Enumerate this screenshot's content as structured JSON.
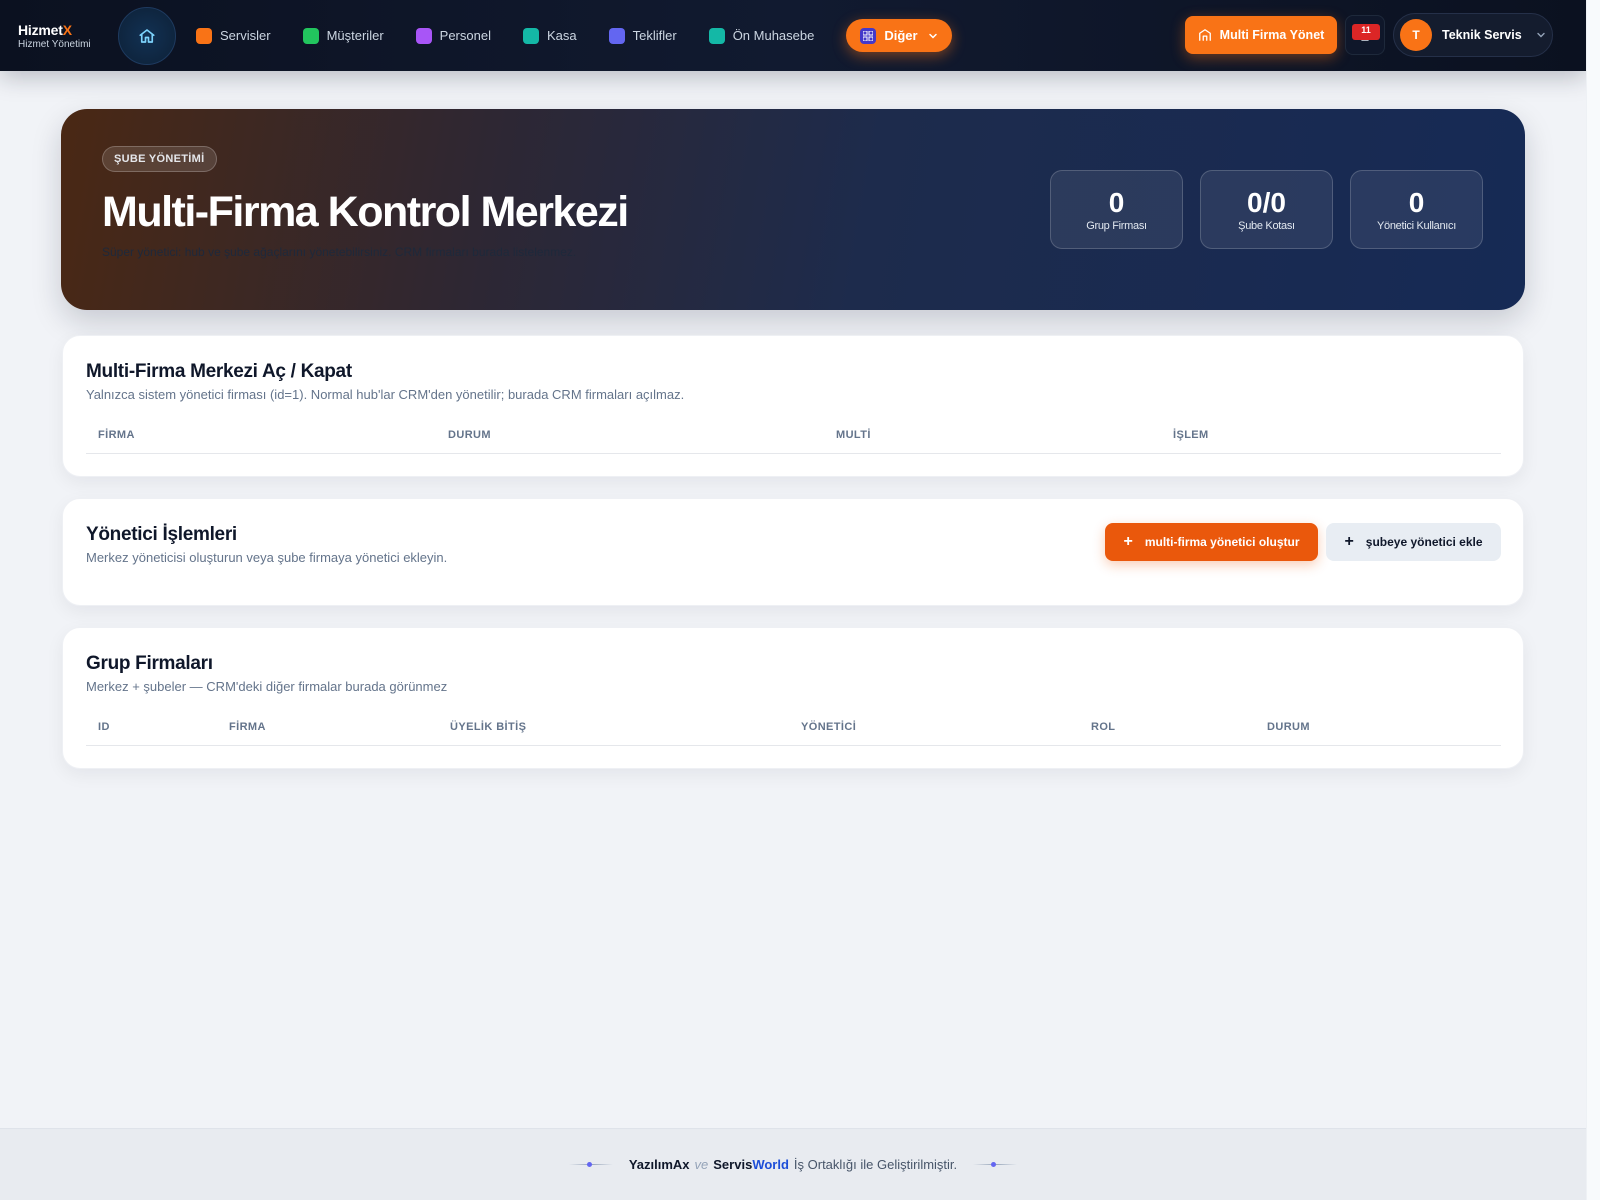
{
  "brand": {
    "name_main": "Hizmet",
    "name_accent": "X",
    "subtitle": "Hizmet Yönetimi"
  },
  "nav": {
    "items": [
      {
        "label": "Servisler",
        "color": "#f97316"
      },
      {
        "label": "Müşteriler",
        "color": "#22c55e"
      },
      {
        "label": "Personel",
        "color": "#a855f7"
      },
      {
        "label": "Kasa",
        "color": "#14b8a6"
      },
      {
        "label": "Teklifler",
        "color": "#6366f1"
      },
      {
        "label": "Ön Muhasebe",
        "color": "#14b8a6"
      }
    ],
    "more_label": "Diğer",
    "multi_firma_label": "Multi Firma Yönet",
    "notification_count": "11",
    "user_initial": "T",
    "user_name": "Teknik Servis"
  },
  "hero": {
    "tag": "ŞUBE YÖNETİMİ",
    "title": "Multi-Firma Kontrol Merkezi",
    "description": "Süper yönetici: hub ve şube ağaçlarını yönetebilirsiniz. CRM firmaları burada listelenmez.",
    "stats": [
      {
        "value": "0",
        "label": "Grup Firması"
      },
      {
        "value": "0/0",
        "label": "Şube Kotası"
      },
      {
        "value": "0",
        "label": "Yönetici Kullanıcı"
      }
    ]
  },
  "toggle_card": {
    "title": "Multi-Firma Merkezi Aç / Kapat",
    "subtitle": "Yalnızca sistem yönetici firması (id=1). Normal hub'lar CRM'den yönetilir; burada CRM firmaları açılmaz.",
    "columns": [
      "FİRMA",
      "DURUM",
      "MULTİ",
      "İŞLEM"
    ]
  },
  "admin_card": {
    "title": "Yönetici İşlemleri",
    "subtitle": "Merkez yöneticisi oluşturun veya şube firmaya yönetici ekleyin.",
    "primary_button": "multi-firma yönetici oluştur",
    "secondary_button": "şubeye yönetici ekle"
  },
  "group_card": {
    "title": "Grup Firmaları",
    "subtitle": "Merkez + şubeler — CRM'deki diğer firmalar burada görünmez",
    "columns": [
      "ID",
      "FİRMA",
      "ÜYELİK BİTİŞ",
      "YÖNETİCİ",
      "ROL",
      "DURUM"
    ]
  },
  "footer": {
    "brand1": "YazılımAx",
    "and": "ve",
    "brand2_a": "Servis",
    "brand2_b": "World",
    "text": "İş Ortaklığı ile Geliştirilmiştir."
  },
  "colors": {
    "accent": "#f97316",
    "navy": "#0b1120"
  }
}
